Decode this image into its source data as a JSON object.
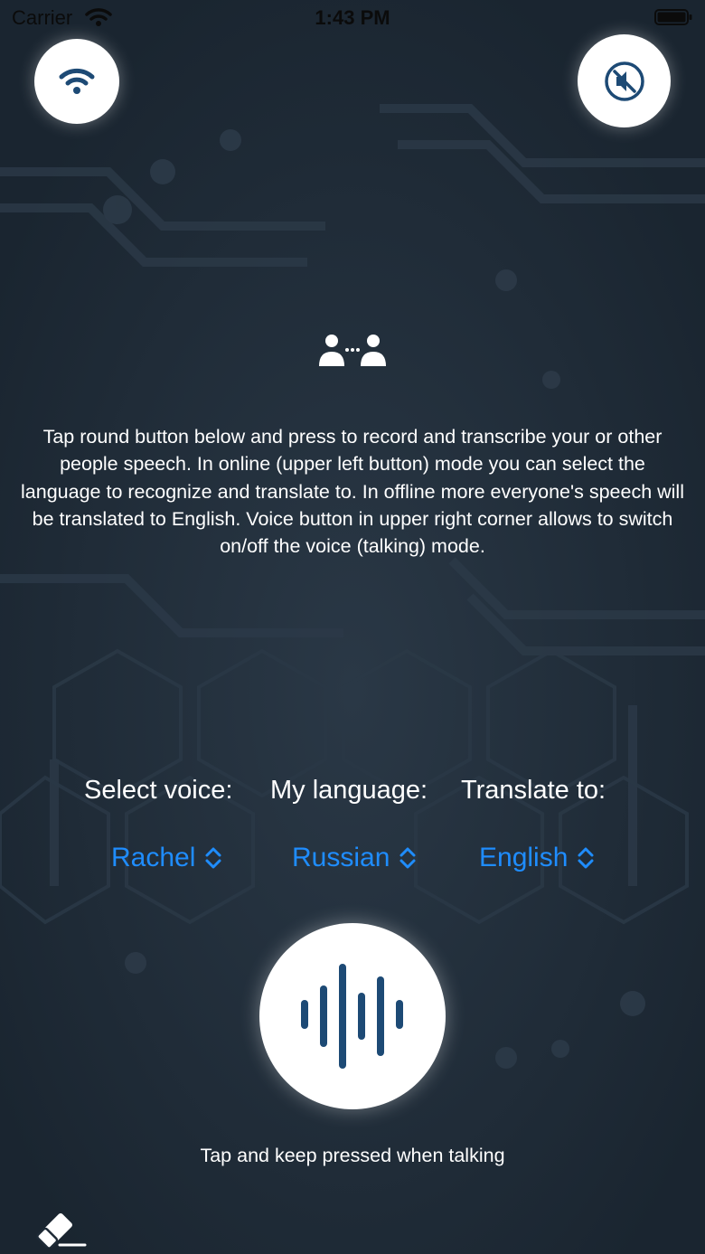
{
  "status_bar": {
    "carrier": "Carrier",
    "time": "1:43 PM"
  },
  "top_buttons": {
    "online_icon": "wifi-icon",
    "voice_icon": "speaker-muted-icon"
  },
  "info": {
    "icon": "people-conversation-icon",
    "instructions": "Tap round button below and press to record and transcribe your or other people speech. In online (upper left button) mode you can select the language to recognize and translate to. In offline more everyone's speech will be translated to English. Voice button in upper right corner allows to switch on/off the voice (talking) mode."
  },
  "selectors": {
    "voice_label": "Select voice:",
    "language_label": "My language:",
    "translate_label": "Translate to:",
    "voice_value": "Rachel",
    "language_value": "Russian",
    "translate_value": "English"
  },
  "record": {
    "icon": "sound-wave-icon",
    "hint": "Tap and keep pressed when talking"
  },
  "bottom": {
    "clear_icon": "eraser-icon"
  },
  "colors": {
    "background": "#1e2a36",
    "accent": "#1f8dff",
    "icon_dark": "#1d4a75"
  }
}
